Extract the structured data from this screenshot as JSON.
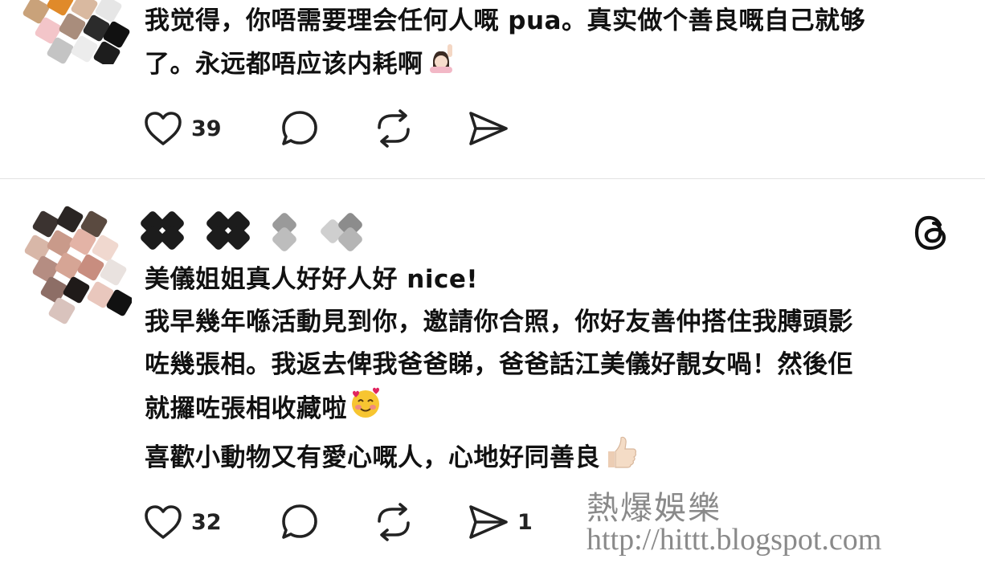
{
  "posts": [
    {
      "lines": [
        "我觉得，你唔需要理会任何人嘅 pua。真实做个善良嘅自己就够",
        "了。永远都唔应该内耗啊"
      ],
      "emoji": "person-raising-hand-emoji",
      "actions": {
        "likes": "39",
        "reposts": "",
        "shares": ""
      }
    },
    {
      "lines": [
        "美儀姐姐真人好好人好 nice!",
        "我早幾年喺活動見到你，邀請你合照，你好友善仲搭住我膊頭影",
        "咗幾張相。我返去俾我爸爸睇，爸爸話江美儀好靚女喎！然後佢",
        "就攞咗張相收藏啦",
        "喜歡小動物又有愛心嘅人，心地好同善良"
      ],
      "emojis": [
        "smiling-face-with-hearts-emoji",
        "thumbs-up-emoji"
      ],
      "actions": {
        "likes": "32",
        "reposts": "",
        "shares": "1"
      },
      "badge_icon": "threads-logo-icon"
    }
  ],
  "watermark": {
    "title": "熱爆娛樂",
    "url": "http://hittt.blogspot.com"
  },
  "colors": {
    "text": "#111111",
    "icon": "#222222",
    "divider": "#e3e3e3",
    "watermark": "#8a8a8a"
  }
}
